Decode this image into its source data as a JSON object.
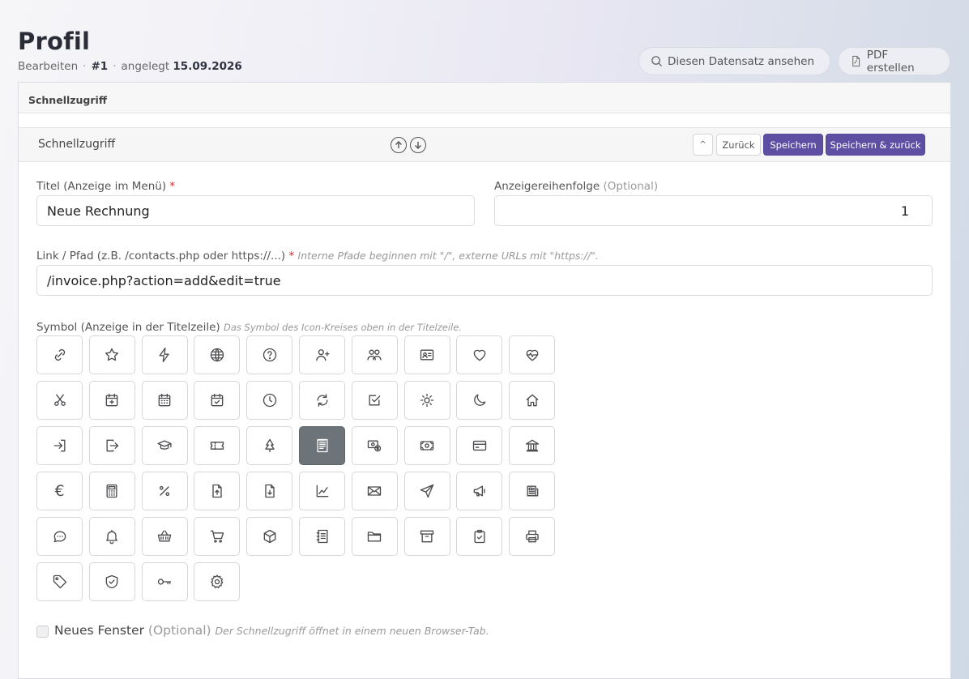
{
  "header": {
    "title": "Profil",
    "breadcrumb_action": "Bearbeiten",
    "record_id": "#1",
    "created_label": "angelegt",
    "created_date": "15.09.2026",
    "view_button": "Diesen Datensatz ansehen",
    "pdf_button": "PDF erstellen"
  },
  "card": {
    "title": "Schnellzugriff"
  },
  "section": {
    "title": "Schnellzugriff",
    "collapse_glyph": "^",
    "back_button": "Zurück",
    "save_button": "Speichern",
    "save_back_button": "Speichern & zurück"
  },
  "form": {
    "title_label": "Titel (Anzeige im Menü)",
    "title_required": "*",
    "title_value": "Neue Rechnung",
    "order_label": "Anzeigereihenfolge",
    "order_optional": "(Optional)",
    "order_value": "1",
    "link_label": "Link / Pfad (z.B. /contacts.php oder https://...)",
    "link_required": "*",
    "link_hint": "Interne Pfade beginnen mit \"/\", externe URLs mit \"https://\".",
    "link_value": "/invoice.php?action=add&edit=true",
    "symbol_label": "Symbol (Anzeige in der Titelzeile)",
    "symbol_hint": "Das Symbol des Icon-Kreises oben in der Titelzeile.",
    "selected_icon": "invoice-receipt-icon",
    "newwin_label": "Neues Fenster",
    "newwin_optional": "(Optional)",
    "newwin_hint": "Der Schnellzugriff öffnet in einem neuen Browser-Tab.",
    "newwin_checked": false
  },
  "icons": [
    "link-icon",
    "star-icon",
    "lightning-icon",
    "globe-icon",
    "question-icon",
    "add-user-icon",
    "users-icon",
    "id-card-icon",
    "heart-icon",
    "heart-pulse-icon",
    "scissors-icon",
    "calendar-plus-icon",
    "calendar-grid-icon",
    "calendar-check-icon",
    "clock-icon",
    "refresh-icon",
    "checkbox-icon",
    "sun-icon",
    "moon-icon",
    "house-icon",
    "sign-in-icon",
    "sign-out-icon",
    "graduation-cap-icon",
    "ticket-icon",
    "tree-icon",
    "invoice-receipt-icon",
    "dollar-cash-icon",
    "money-bill-icon",
    "credit-card-icon",
    "bank-icon",
    "euro-icon",
    "calculator-icon",
    "percent-icon",
    "file-upload-icon",
    "file-download-icon",
    "line-chart-icon",
    "envelope-icon",
    "send-icon",
    "megaphone-icon",
    "newspaper-icon",
    "chat-icon",
    "bell-icon",
    "basket-icon",
    "cart-icon",
    "box-icon",
    "notebook-icon",
    "folder-icon",
    "archive-icon",
    "clipboard-check-icon",
    "printer-icon",
    "tag-icon",
    "shield-check-icon",
    "key-icon",
    "gear-icon"
  ]
}
